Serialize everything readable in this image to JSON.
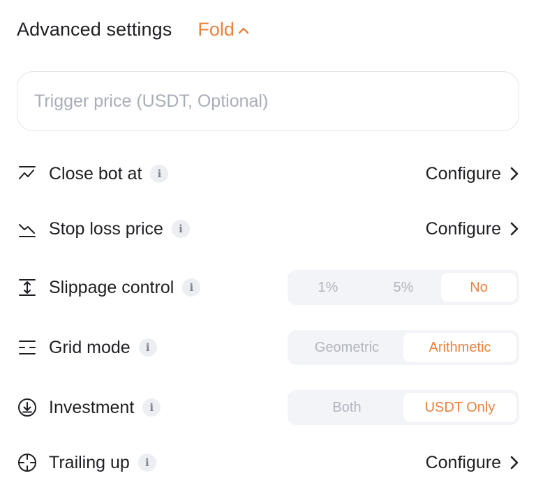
{
  "header": {
    "title": "Advanced settings",
    "fold_label": "Fold"
  },
  "trigger": {
    "placeholder": "Trigger price (USDT, Optional)",
    "value": ""
  },
  "rows": {
    "close_bot": {
      "label": "Close bot at",
      "action": "Configure",
      "icon": "chart-up-icon"
    },
    "stop_loss": {
      "label": "Stop loss price",
      "action": "Configure",
      "icon": "chart-down-icon"
    },
    "slippage": {
      "label": "Slippage control",
      "icon": "slippage-icon",
      "options": [
        "1%",
        "5%",
        "No"
      ],
      "selected": "No"
    },
    "grid_mode": {
      "label": "Grid mode",
      "icon": "grid-lines-icon",
      "options": [
        "Geometric",
        "Arithmetic"
      ],
      "selected": "Arithmetic"
    },
    "investment": {
      "label": "Investment",
      "icon": "download-circle-icon",
      "options": [
        "Both",
        "USDT Only"
      ],
      "selected": "USDT Only"
    },
    "trailing_up": {
      "label": "Trailing up",
      "action": "Configure",
      "icon": "crosshair-icon"
    }
  },
  "info_glyph": "i",
  "colors": {
    "accent": "#e9813f",
    "text": "#1f1f23",
    "muted": "#b0b4bf",
    "segment_bg": "#f3f4f7",
    "border": "#e3e4ea"
  }
}
